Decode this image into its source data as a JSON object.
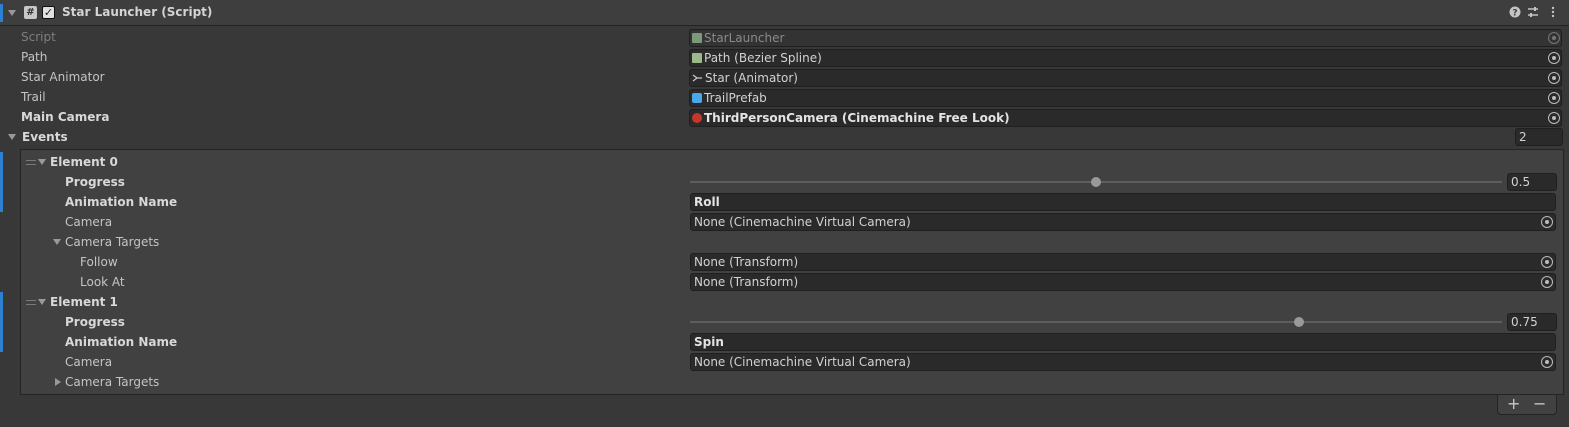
{
  "component": {
    "title": "Star Launcher (Script)",
    "enabled_check": "✓",
    "header_icons": [
      "help-icon",
      "preset-icon",
      "more-icon"
    ]
  },
  "fields": {
    "script": {
      "label": "Script",
      "value": "StarLauncher"
    },
    "path": {
      "label": "Path",
      "value": "Path (Bezier Spline)"
    },
    "star_animator": {
      "label": "Star Animator",
      "value": "Star (Animator)"
    },
    "trail": {
      "label": "Trail",
      "value": "TrailPrefab"
    },
    "main_camera": {
      "label": "Main Camera",
      "value": "ThirdPersonCamera (Cinemachine Free Look)"
    }
  },
  "events": {
    "label": "Events",
    "count": "2",
    "elements": [
      {
        "label": "Element 0",
        "progress_label": "Progress",
        "progress_value": "0.5",
        "progress_fraction": 0.5,
        "animation_label": "Animation Name",
        "animation_value": "Roll",
        "camera_label": "Camera",
        "camera_value": "None (Cinemachine Virtual Camera)",
        "camera_targets_label": "Camera Targets",
        "follow_label": "Follow",
        "follow_value": "None (Transform)",
        "look_at_label": "Look At",
        "look_at_value": "None (Transform)"
      },
      {
        "label": "Element 1",
        "progress_label": "Progress",
        "progress_value": "0.75",
        "progress_fraction": 0.75,
        "animation_label": "Animation Name",
        "animation_value": "Spin",
        "camera_label": "Camera",
        "camera_value": "None (Cinemachine Virtual Camera)",
        "camera_targets_label": "Camera Targets"
      }
    ],
    "add_label": "+",
    "remove_label": "−"
  },
  "colors": {
    "background": "#383838",
    "field": "#2a2a2a",
    "accent": "#2d7fd0"
  }
}
